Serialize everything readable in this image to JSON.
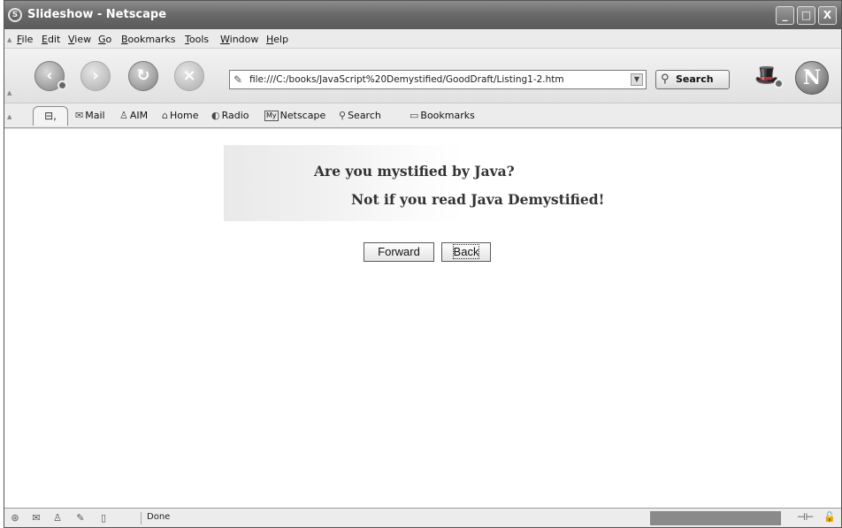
{
  "window": {
    "title": "Slideshow - Netscape",
    "controls": {
      "minimize": "_",
      "maximize": "□",
      "close": "X"
    }
  },
  "menubar": {
    "items": [
      {
        "label": "File",
        "accel": "F",
        "rest": "ile"
      },
      {
        "label": "Edit",
        "accel": "E",
        "rest": "dit"
      },
      {
        "label": "View",
        "accel": "V",
        "rest": "iew"
      },
      {
        "label": "Go",
        "accel": "G",
        "rest": "o"
      },
      {
        "label": "Bookmarks",
        "accel": "B",
        "rest": "ookmarks"
      },
      {
        "label": "Tools",
        "accel": "T",
        "rest": "ools"
      },
      {
        "label": "Window",
        "accel": "W",
        "rest": "indow"
      },
      {
        "label": "Help",
        "accel": "H",
        "rest": "elp"
      }
    ]
  },
  "navigation": {
    "back_icon": "back-arrow-icon",
    "forward_icon": "forward-arrow-icon",
    "reload_icon": "reload-icon",
    "stop_icon": "stop-icon",
    "url": "file:///C:/books/JavaScript%20Demystified/GoodDraft/Listing1-2.htm",
    "search_label": "Search"
  },
  "personal_toolbar": {
    "items": [
      {
        "label": "Mail",
        "icon": "mail-icon"
      },
      {
        "label": "AIM",
        "icon": "aim-icon"
      },
      {
        "label": "Home",
        "icon": "home-icon"
      },
      {
        "label": "Radio",
        "icon": "radio-icon"
      },
      {
        "label": "Netscape",
        "icon": "my-netscape-icon",
        "icon_text": "My"
      },
      {
        "label": "Search",
        "icon": "search-icon"
      },
      {
        "label": "Bookmarks",
        "icon": "bookmarks-folder-icon"
      }
    ]
  },
  "page": {
    "banner_line1": "Are you mystified by Java?",
    "banner_line2": "Not if you read Java Demystified!",
    "forward_button": "Forward",
    "back_button": "Back"
  },
  "statusbar": {
    "status_text": "Done",
    "progress": 1.0
  }
}
